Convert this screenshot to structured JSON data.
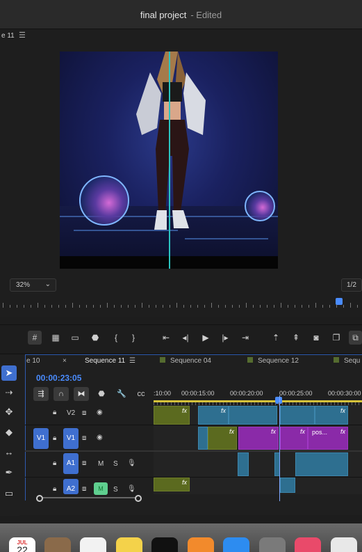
{
  "window": {
    "title": "final project",
    "status": "- Edited"
  },
  "monitor": {
    "tab_label": "e 11",
    "zoom": "32%",
    "resolution": "1/2"
  },
  "timeline": {
    "tabs": [
      "e 10",
      "Sequence 11",
      "Sequence 04",
      "Sequence 12",
      "Sequ"
    ],
    "close_label": "×",
    "timecode": "00:00:23:05",
    "ruler_labels": [
      ":10:00",
      "00:00:15:00",
      "00:00:20:00",
      "00:00:25:00",
      "00:00:30:00"
    ],
    "tracks": {
      "v2": "V2",
      "v1": "V1",
      "v1_target": "V1",
      "a1": "A1",
      "a2": "A2",
      "m": "M",
      "s": "S"
    },
    "clip_labels": {
      "fx": "fx",
      "pos": "pos..."
    }
  },
  "dock": {
    "calendar_month": "JUL",
    "calendar_day": "22"
  },
  "colors": {
    "accent": "#4a8cff",
    "playhead": "#2bc4c0",
    "video_clip": "#2e6f90",
    "purple_clip": "#8a2aa8",
    "olive_clip": "#5b6a1f"
  }
}
